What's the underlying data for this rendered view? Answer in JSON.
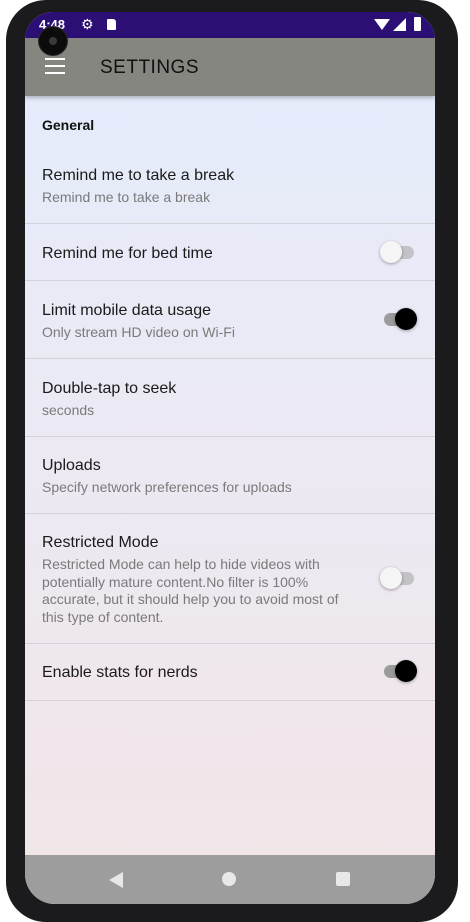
{
  "status_bar": {
    "time": "4:48"
  },
  "app_bar": {
    "title": "SETTINGS"
  },
  "section": {
    "header": "General"
  },
  "preferences": [
    {
      "title": "Remind me to take a break",
      "summary": "Remind me to take a break"
    },
    {
      "title": "Remind me for bed time",
      "toggle": "off"
    },
    {
      "title": "Limit mobile data usage",
      "summary": "Only stream HD video on Wi-Fi",
      "toggle": "on"
    },
    {
      "title": "Double-tap to seek",
      "summary": "seconds"
    },
    {
      "title": "Uploads",
      "summary": "Specify network preferences for uploads"
    },
    {
      "title": "Restricted Mode",
      "summary": "Restricted Mode can help to hide videos with potentially mature content.No filter is 100% accurate, but it should help you to avoid most of this type of content.",
      "toggle": "off"
    },
    {
      "title": "Enable stats for nerds",
      "toggle": "on"
    }
  ],
  "colors": {
    "status_bar": "#2b0f75",
    "app_bar": "#858680",
    "switch_on_thumb": "#000000",
    "switch_off_thumb": "#f5f5f5"
  }
}
